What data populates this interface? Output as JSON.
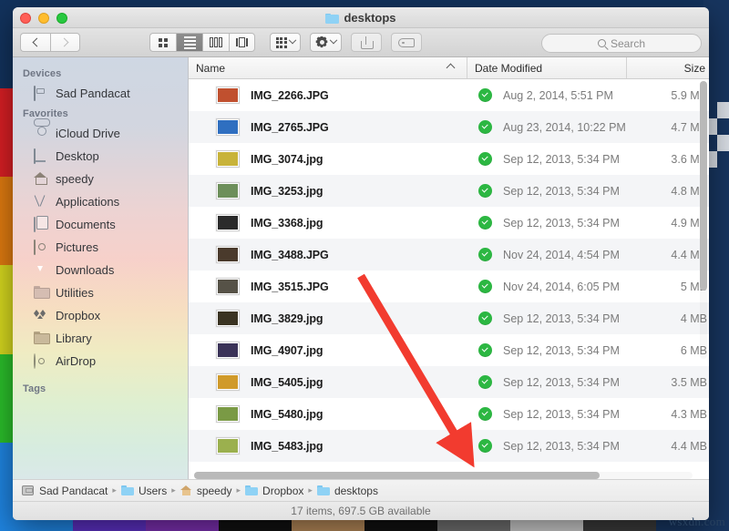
{
  "window": {
    "title": "desktops",
    "title_icon": "folder-icon",
    "traffic_lights": [
      "close-button",
      "minimize-button",
      "zoom-button"
    ]
  },
  "toolbar": {
    "back_label": "Back",
    "forward_label": "Forward",
    "views": [
      {
        "name": "icon-view",
        "icon": "grid-icon",
        "active": false
      },
      {
        "name": "list-view",
        "icon": "list-icon",
        "active": true
      },
      {
        "name": "column-view",
        "icon": "columns-icon",
        "active": false
      },
      {
        "name": "coverflow-view",
        "icon": "coverflow-icon",
        "active": false
      }
    ],
    "arrange_label": "Arrange",
    "action_label": "Action",
    "share_label": "Share",
    "tag_label": "Tags",
    "search": {
      "placeholder": "Search",
      "value": "",
      "icon": "search-icon"
    }
  },
  "sidebar": {
    "sections": [
      {
        "header": "Devices",
        "items": [
          {
            "label": "Sad Pandacat",
            "icon": "hard-drive-icon"
          }
        ]
      },
      {
        "header": "Favorites",
        "items": [
          {
            "label": "iCloud Drive",
            "icon": "cloud-icon"
          },
          {
            "label": "Desktop",
            "icon": "desktop-icon"
          },
          {
            "label": "speedy",
            "icon": "home-icon"
          },
          {
            "label": "Applications",
            "icon": "applications-icon"
          },
          {
            "label": "Documents",
            "icon": "documents-icon"
          },
          {
            "label": "Pictures",
            "icon": "pictures-icon"
          },
          {
            "label": "Downloads",
            "icon": "downloads-icon"
          },
          {
            "label": "Utilities",
            "icon": "folder-icon"
          },
          {
            "label": "Dropbox",
            "icon": "dropbox-icon"
          },
          {
            "label": "Library",
            "icon": "folder-icon"
          },
          {
            "label": "AirDrop",
            "icon": "airdrop-icon"
          }
        ]
      },
      {
        "header": "Tags",
        "items": []
      }
    ]
  },
  "filelist": {
    "columns": [
      {
        "label": "Name",
        "sort": "ascending"
      },
      {
        "label": "Date Modified",
        "sort": "none"
      },
      {
        "label": "Size",
        "sort": "none"
      }
    ],
    "rows": [
      {
        "name": "IMG_2266.JPG",
        "badge": "synced",
        "date": "Aug 2, 2014, 5:51 PM",
        "size": "5.9 MB",
        "thumb": "#c0502f"
      },
      {
        "name": "IMG_2765.JPG",
        "badge": "synced",
        "date": "Aug 23, 2014, 10:22 PM",
        "size": "4.7 MB",
        "thumb": "#2f6fc0"
      },
      {
        "name": "IMG_3074.jpg",
        "badge": "synced",
        "date": "Sep 12, 2013, 5:34 PM",
        "size": "3.6 MB",
        "thumb": "#c8b33a"
      },
      {
        "name": "IMG_3253.jpg",
        "badge": "synced",
        "date": "Sep 12, 2013, 5:34 PM",
        "size": "4.8 MB",
        "thumb": "#6d8f5a"
      },
      {
        "name": "IMG_3368.jpg",
        "badge": "synced",
        "date": "Sep 12, 2013, 5:34 PM",
        "size": "4.9 MB",
        "thumb": "#2b2b2b"
      },
      {
        "name": "IMG_3488.JPG",
        "badge": "synced",
        "date": "Nov 24, 2014, 4:54 PM",
        "size": "4.4 MB",
        "thumb": "#4a3a2c"
      },
      {
        "name": "IMG_3515.JPG",
        "badge": "synced",
        "date": "Nov 24, 2014, 6:05 PM",
        "size": "5 MB",
        "thumb": "#565247"
      },
      {
        "name": "IMG_3829.jpg",
        "badge": "synced",
        "date": "Sep 12, 2013, 5:34 PM",
        "size": "4 MB",
        "thumb": "#3a3322"
      },
      {
        "name": "IMG_4907.jpg",
        "badge": "synced",
        "date": "Sep 12, 2013, 5:34 PM",
        "size": "6 MB",
        "thumb": "#3b3358"
      },
      {
        "name": "IMG_5405.jpg",
        "badge": "synced",
        "date": "Sep 12, 2013, 5:34 PM",
        "size": "3.5 MB",
        "thumb": "#d09a2a"
      },
      {
        "name": "IMG_5480.jpg",
        "badge": "synced",
        "date": "Sep 12, 2013, 5:34 PM",
        "size": "4.3 MB",
        "thumb": "#7a9a45"
      },
      {
        "name": "IMG_5483.jpg",
        "badge": "synced",
        "date": "Sep 12, 2013, 5:34 PM",
        "size": "4.4 MB",
        "thumb": "#9bb04e"
      }
    ]
  },
  "pathbar": {
    "items": [
      {
        "label": "Sad Pandacat",
        "icon": "hard-drive-icon"
      },
      {
        "label": "Users",
        "icon": "folder-icon"
      },
      {
        "label": "speedy",
        "icon": "home-icon"
      },
      {
        "label": "Dropbox",
        "icon": "folder-icon"
      },
      {
        "label": "desktops",
        "icon": "folder-icon"
      }
    ],
    "separator": "▸"
  },
  "statusbar": {
    "text": "17 items, 697.5 GB available"
  },
  "annotation": {
    "type": "arrow",
    "color": "#f23b2f"
  },
  "desktop": {
    "background_color": "#12325c",
    "left_bands": [
      "#12325c",
      "#d81f24",
      "#e07b10",
      "#d6d81f",
      "#2bbf2b",
      "#1f84e0"
    ],
    "bottom_blocks": [
      "#1f84e0",
      "#5b30c0",
      "#7a2fae",
      "#111111",
      "#b08556",
      "#111111",
      "#6e6e6e",
      "#c9c9c9",
      "#3a3a3a",
      "#17355f"
    ]
  },
  "watermark": {
    "text": "wsxdn.com"
  }
}
